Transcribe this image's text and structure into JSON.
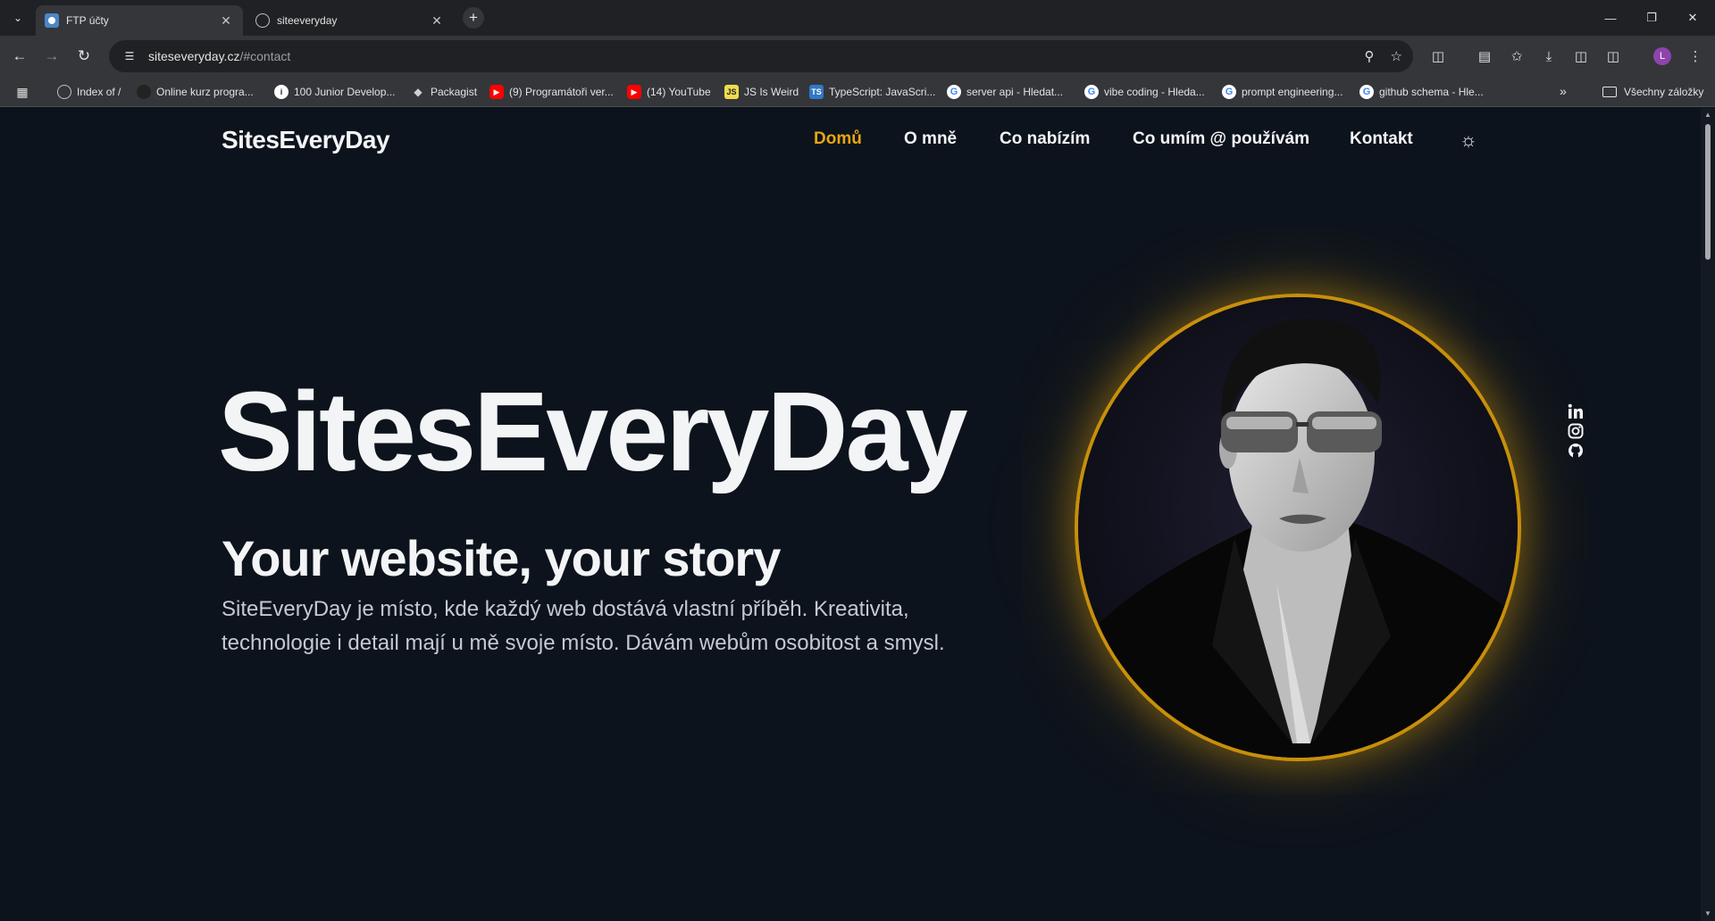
{
  "browser": {
    "tabs": [
      {
        "title": "FTP účty",
        "active": true
      },
      {
        "title": "siteeveryday",
        "active": false
      }
    ],
    "url": {
      "host": "siteseveryday.cz",
      "path": "/#contact"
    },
    "bookmarks": [
      {
        "label": "Index of /",
        "icon": "globe-icon"
      },
      {
        "label": "Online kurz progra...",
        "icon": "dark-site-icon"
      },
      {
        "label": "100 Junior Develop...",
        "icon": "info-icon"
      },
      {
        "label": "Packagist",
        "icon": "gem-icon"
      },
      {
        "label": "(9) Programátoři ver...",
        "icon": "youtube-icon"
      },
      {
        "label": "(14) YouTube",
        "icon": "youtube-icon"
      },
      {
        "label": "JS Is Weird",
        "icon": "js-icon"
      },
      {
        "label": "TypeScript: JavaScri...",
        "icon": "ts-icon"
      },
      {
        "label": "server api - Hledat...",
        "icon": "google-icon"
      },
      {
        "label": "vibe coding - Hleda...",
        "icon": "google-icon"
      },
      {
        "label": "prompt engineering...",
        "icon": "google-icon"
      },
      {
        "label": "github schema - Hle...",
        "icon": "google-icon"
      }
    ],
    "bookmarks_folder": "Všechny záložky",
    "profile_initial": "L"
  },
  "site": {
    "brand": "SitesEveryDay",
    "nav": [
      {
        "label": "Domů",
        "active": true
      },
      {
        "label": "O mně",
        "active": false
      },
      {
        "label": "Co nabízím",
        "active": false
      },
      {
        "label": "Co umím @ používám",
        "active": false
      },
      {
        "label": "Kontakt",
        "active": false
      }
    ],
    "hero": {
      "title": "SitesEveryDay",
      "subtitle": "Your website, your story",
      "description": "SiteEveryDay je místo, kde každý web dostává vlastní příběh. Kreativita, technologie i detail mají u mě svoje místo. Dávám webům osobitost a smysl."
    },
    "social": [
      "linkedin-icon",
      "instagram-icon",
      "github-icon"
    ]
  },
  "colors": {
    "background": "#0d131c",
    "accent": "#e7a614",
    "text": "#f3f4f6",
    "muted_text": "#c4c9d2"
  }
}
